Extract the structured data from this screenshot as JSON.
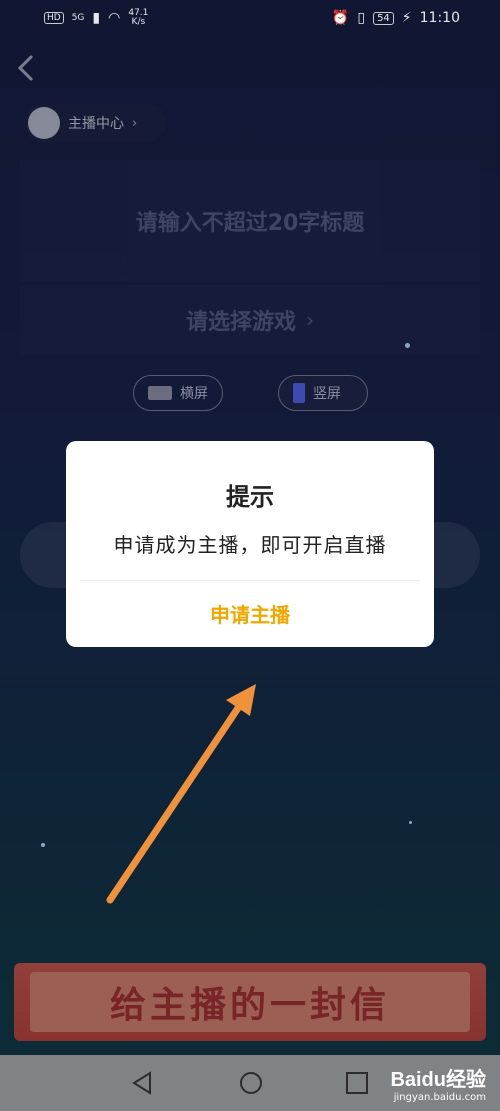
{
  "status_bar": {
    "hd": "HD",
    "net_gen": "5G",
    "speed_value": "47.1",
    "speed_unit": "K/s",
    "battery": "54",
    "time": "11:10"
  },
  "host_center": {
    "label": "主播中心",
    "arrow": "›"
  },
  "title_input": {
    "placeholder": "请输入不超过20字标题"
  },
  "game_select": {
    "label": "请选择游戏",
    "arrow": "›"
  },
  "orientation": {
    "landscape": "横屏",
    "portrait": "竖屏"
  },
  "dialog": {
    "title": "提示",
    "message": "申请成为主播，即可开启直播",
    "confirm": "申请主播"
  },
  "letter_banner": {
    "label": "给主播的一封信"
  },
  "watermark": {
    "brand": "Baidu经验",
    "url": "jingyan.baidu.com"
  },
  "colors": {
    "accent": "#f0a800",
    "arrow": "#f0923c",
    "banner": "#d94c3f"
  }
}
